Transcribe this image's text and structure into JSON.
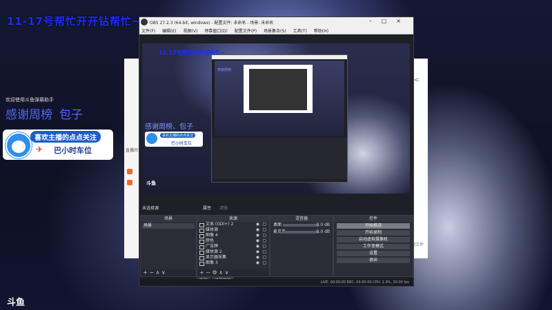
{
  "overlay": {
    "banner": "11-17号帮忙开开钻帮忙~",
    "danmu_title": "欢迎使用斗鱼弹幕助手",
    "thanks": "感谢周榜",
    "thanks_name": "包子",
    "follow_line1": "喜欢主播的点点关注",
    "follow_line2": "巴小时车位",
    "logo": "斗鱼"
  },
  "browser": {
    "side_label": "直播间",
    "right_text": "示例文件",
    "share": "<"
  },
  "obs": {
    "title": "OBS 27.2.3 (64-bit, windows) - 配置文件: 未命名 - 场景: 未命名",
    "menu": [
      "文件(F)",
      "编辑(E)",
      "视图(V)",
      "停靠窗口(D)",
      "配置文件(P)",
      "场景集合(S)",
      "工具(T)",
      "帮助(H)"
    ],
    "window_controls": "–□×",
    "preview_text": "11-17号帮忙开开钻帮忙~",
    "preview_thanks": "感谢周榜、包子",
    "preview_card_l1": "喜欢主播的点点关注",
    "preview_card_l2": "巴小时车位",
    "preview_logo": "斗鱼",
    "nested_text": "感谢周榜",
    "context_bar": "未选择源",
    "context_btn1": "属性",
    "context_btn2": "滤镜",
    "scenes": {
      "header": "场景",
      "items": [
        "场景"
      ],
      "footer": "+ − ∧ ∨"
    },
    "sources": {
      "header": "来源",
      "items": [
        "文本 (GDI+) 2",
        "媒体源",
        "图像 4",
        "颜色",
        "广告牌",
        "媒体源 2",
        "显示器采集",
        "图像 3"
      ],
      "footer": "+ − ⚙ ∧ ∨"
    },
    "mixer": {
      "header": "混音器",
      "rows": [
        {
          "label": "桌面",
          "db": "0.0 dB"
        },
        {
          "label": "麦克风",
          "db": "0.0 dB"
        }
      ]
    },
    "controls": {
      "header": "控件",
      "buttons": [
        "开始推流",
        "开始录制",
        "启动虚拟摄像机",
        "工作室模式",
        "设置",
        "退出"
      ]
    },
    "tabs": [
      "来源",
      "场景转换"
    ],
    "status": "LIVE: 00:00:00   REC: 00:00:00   CPU: 1.9%, 30.00 fps"
  }
}
